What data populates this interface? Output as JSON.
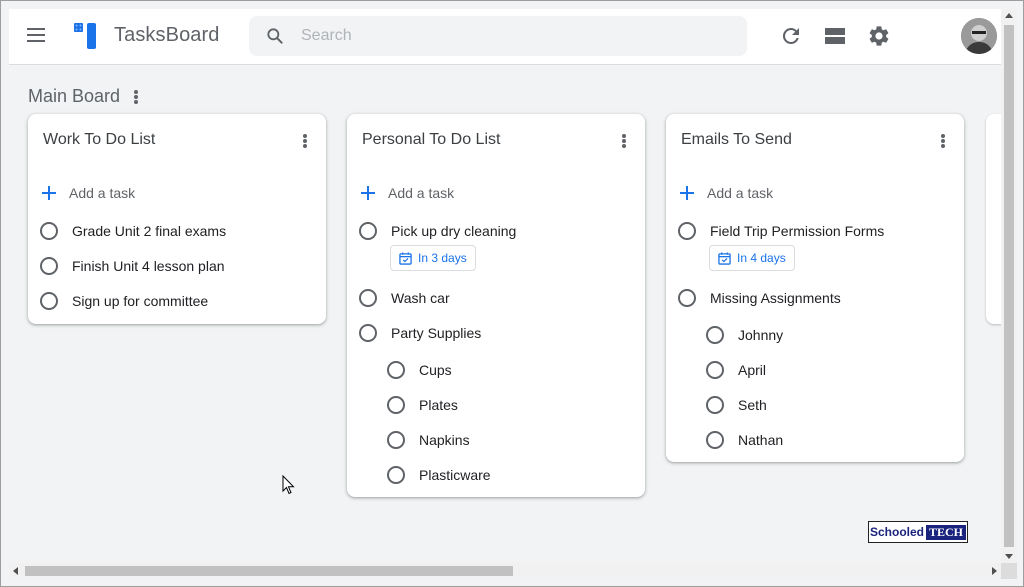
{
  "app": {
    "title": "TasksBoard"
  },
  "search": {
    "placeholder": "Search"
  },
  "header": {
    "icons": [
      "menu-icon",
      "refresh-icon",
      "layout-icon",
      "gear-icon",
      "avatar"
    ]
  },
  "board": {
    "title": "Main Board"
  },
  "add_task_label": "Add a task",
  "lists": [
    {
      "title": "Work To Do List",
      "tasks": [
        {
          "text": "Grade Unit 2 final exams"
        },
        {
          "text": "Finish Unit 4 lesson plan"
        },
        {
          "text": "Sign up for committee"
        }
      ]
    },
    {
      "title": "Personal To Do List",
      "tasks": [
        {
          "text": "Pick up dry cleaning",
          "due": "In 3 days"
        },
        {
          "text": "Wash car"
        },
        {
          "text": "Party Supplies",
          "subtasks": [
            {
              "text": "Cups"
            },
            {
              "text": "Plates"
            },
            {
              "text": "Napkins"
            },
            {
              "text": "Plasticware"
            }
          ]
        }
      ]
    },
    {
      "title": "Emails To Send",
      "tasks": [
        {
          "text": "Field Trip Permission Forms",
          "due": "In 4 days"
        },
        {
          "text": "Missing Assignments",
          "subtasks": [
            {
              "text": "Johnny"
            },
            {
              "text": "April"
            },
            {
              "text": "Seth"
            },
            {
              "text": "Nathan"
            }
          ]
        }
      ]
    }
  ],
  "colors": {
    "accent": "#1a73e8",
    "icon": "#5f6368",
    "background": "#f1f3f4"
  },
  "watermark": {
    "part1": "Schooled",
    "part2": "TECH"
  }
}
